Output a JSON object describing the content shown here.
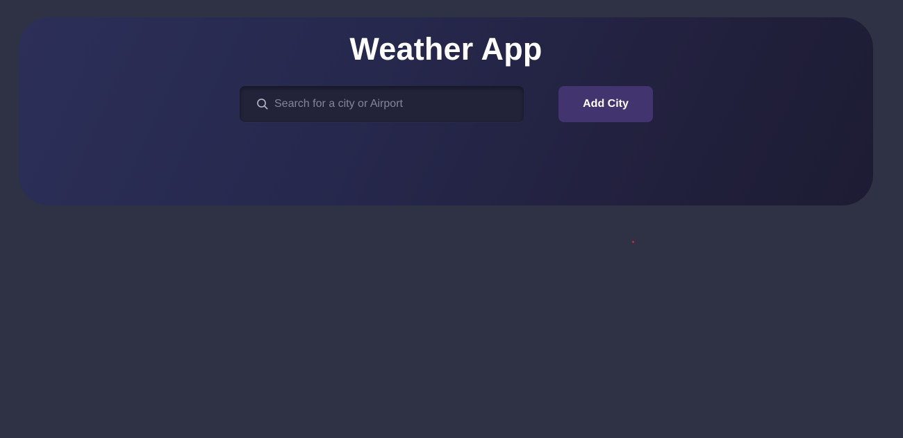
{
  "header": {
    "title": "Weather App"
  },
  "search": {
    "placeholder": "Search for a city or Airport",
    "value": "",
    "icon": "search-icon"
  },
  "actions": {
    "add_city_label": "Add City"
  },
  "colors": {
    "page_background": "#2f3144",
    "header_gradient_start": "#2c2f58",
    "header_gradient_end": "#1d1c33",
    "search_background": "#222239",
    "button_background": "#42346f",
    "text_primary": "#ffffff",
    "placeholder_text": "#85859a"
  }
}
